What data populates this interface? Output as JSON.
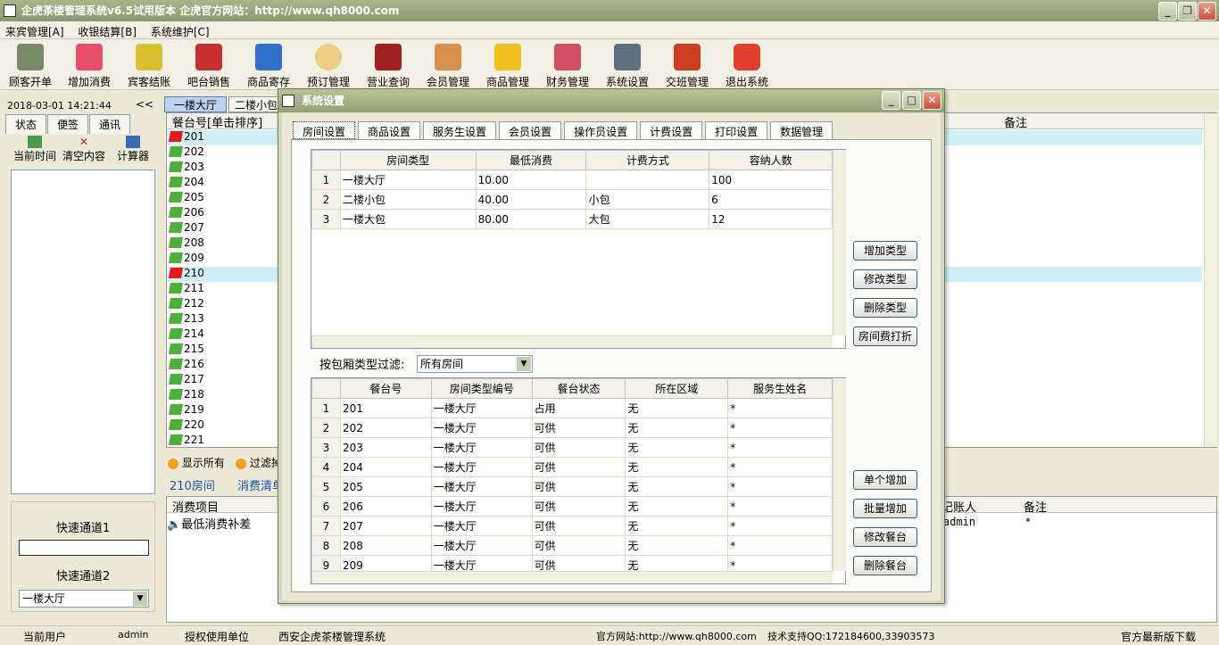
{
  "window": {
    "title": "企虎茶楼管理系统v6.5试用版本 企虎官方网站：http://www.qh8000.com"
  },
  "menu": [
    "来宾管理[A]",
    "收银结算[B]",
    "系统维护[C]"
  ],
  "toolbar": [
    "顾客开单",
    "增加消费",
    "宾客结账",
    "吧台销售",
    "商品寄存",
    "预订管理",
    "营业查询",
    "会员管理",
    "商品管理",
    "财务管理",
    "系统设置",
    "交班管理",
    "退出系统"
  ],
  "left": {
    "datetime": "2018-03-01  14:21:44",
    "collapse": "<<",
    "tabs": [
      "状态",
      "便签",
      "通讯"
    ],
    "tools": [
      "当前时间",
      "清空内容",
      "计算器"
    ],
    "quick1": "快速通道1",
    "quick2": "快速通道2",
    "quick2_value": "一楼大厅"
  },
  "main": {
    "tab1": "一楼大厅",
    "tab2": "二楼小包",
    "col_header": "餐台号[单击排序]",
    "remark_header": "备注",
    "rooms": [
      "201",
      "202",
      "203",
      "204",
      "205",
      "206",
      "207",
      "208",
      "209",
      "210",
      "211",
      "212",
      "213",
      "214",
      "215",
      "216",
      "217",
      "218",
      "219",
      "220",
      "221"
    ],
    "show_all": "显示所有",
    "filter": "过滤掉",
    "room_label": "210房间",
    "consume_label": "消费清单",
    "consume_col": "消费项目",
    "consume_item": "最低消费补差",
    "payer_header": "记账人",
    "payer_value": "admin",
    "remark2_header": "备注",
    "remark2_value": "*"
  },
  "dialog": {
    "title": "系统设置",
    "tabs": [
      "房间设置",
      "商品设置",
      "服务生设置",
      "会员设置",
      "操作员设置",
      "计费设置",
      "打印设置",
      "数据管理"
    ],
    "room_types": {
      "headers": [
        "房间类型",
        "最低消费",
        "计费方式",
        "容纳人数"
      ],
      "rows": [
        [
          "1",
          "一楼大厅",
          "10.00",
          "",
          "100"
        ],
        [
          "2",
          "二楼小包",
          "40.00",
          "小包",
          "6"
        ],
        [
          "3",
          "一楼大包",
          "80.00",
          "大包",
          "12"
        ]
      ]
    },
    "type_buttons": [
      "增加类型",
      "修改类型",
      "删除类型",
      "房间费打折"
    ],
    "filter_label": "按包厢类型过滤:",
    "filter_value": "所有房间",
    "tables": {
      "headers": [
        "餐台号",
        "房间类型编号",
        "餐台状态",
        "所在区域",
        "服务生姓名"
      ],
      "rows": [
        [
          "1",
          "201",
          "一楼大厅",
          "占用",
          "无",
          "*"
        ],
        [
          "2",
          "202",
          "一楼大厅",
          "可供",
          "无",
          "*"
        ],
        [
          "3",
          "203",
          "一楼大厅",
          "可供",
          "无",
          "*"
        ],
        [
          "4",
          "204",
          "一楼大厅",
          "可供",
          "无",
          "*"
        ],
        [
          "5",
          "205",
          "一楼大厅",
          "可供",
          "无",
          "*"
        ],
        [
          "6",
          "206",
          "一楼大厅",
          "可供",
          "无",
          "*"
        ],
        [
          "7",
          "207",
          "一楼大厅",
          "可供",
          "无",
          "*"
        ],
        [
          "8",
          "208",
          "一楼大厅",
          "可供",
          "无",
          "*"
        ],
        [
          "9",
          "209",
          "一楼大厅",
          "可供",
          "无",
          "*"
        ]
      ]
    },
    "table_buttons": [
      "单个增加",
      "批量增加",
      "修改餐台",
      "删除餐台"
    ]
  },
  "status": {
    "user_label": "当前用户",
    "user": "admin",
    "auth_label": "授权使用单位",
    "company": "西安企虎茶楼管理系统",
    "site": "官方网站:http://www.qh8000.com",
    "support": "技术支持QQ:172184600,33903573",
    "download": "官方最新版下载"
  }
}
